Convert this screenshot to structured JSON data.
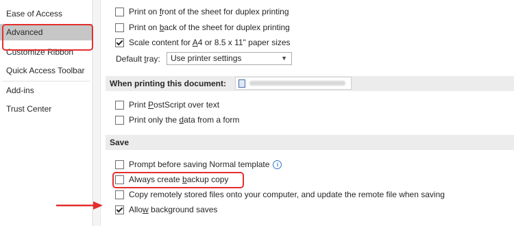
{
  "sidebar": {
    "items": [
      {
        "label": "Ease of Access"
      },
      {
        "label": "Advanced"
      },
      {
        "label": "Customize Ribbon"
      },
      {
        "label": "Quick Access Toolbar"
      },
      {
        "label": "Add-ins"
      },
      {
        "label": "Trust Center"
      }
    ],
    "selected": "Advanced"
  },
  "print": {
    "front_duplex": {
      "pre": "Print on ",
      "u": "f",
      "post": "ront of the sheet for duplex printing",
      "checked": false
    },
    "back_duplex": {
      "pre": "Print on ",
      "u": "b",
      "post": "ack of the sheet for duplex printing",
      "checked": false
    },
    "scale": {
      "pre": "Scale content for ",
      "u": "A",
      "post": "4 or 8.5 x 11\" paper sizes",
      "checked": true
    },
    "tray_label_pre": "Default ",
    "tray_label_u": "t",
    "tray_label_post": "ray:",
    "tray_value": "Use printer settings"
  },
  "when_printing": {
    "label": "When printing this document:",
    "postscript": {
      "pre": "Print ",
      "u": "P",
      "post": "ostScript over text",
      "checked": false
    },
    "data_only": {
      "pre": "Print only the ",
      "u": "d",
      "post": "ata from a form",
      "checked": false
    }
  },
  "save": {
    "title": "Save",
    "prompt": {
      "label": "Prompt before saving Normal template",
      "checked": false
    },
    "backup": {
      "pre": "Always create ",
      "u": "b",
      "post": "ackup copy",
      "checked": false
    },
    "copy_remote": {
      "label": "Copy remotely stored files onto your computer, and update the remote file when saving",
      "checked": false
    },
    "background": {
      "pre": "Allo",
      "u": "w",
      "post": " background saves",
      "checked": true
    }
  },
  "colors": {
    "highlight": "#e52d2d",
    "selected_bg": "#c6c6c6",
    "section_bg": "#ececec"
  }
}
